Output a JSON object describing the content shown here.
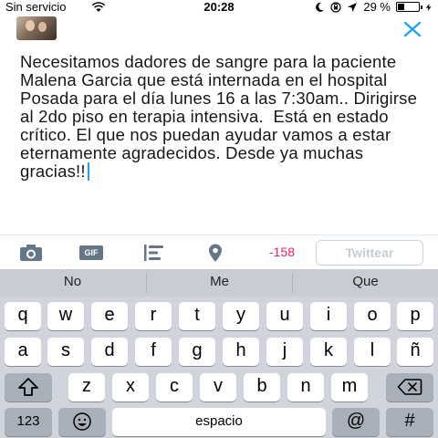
{
  "status_bar": {
    "carrier": "Sin servicio",
    "time": "20:28",
    "battery": "29 %",
    "battery_level": 0.29
  },
  "compose": {
    "tweet_text": "Necesitamos dadores de sangre para la paciente Malena Garcia que está internada en el hospital Posada para el día lunes 16 a las 7:30am.. Dirigirse al 2do piso en terapia intensiva.  Está en estado crítico. El que nos puedan ayudar vamos a estar eternamente agradecidos. Desde ya muchas gracias!!",
    "colors": {
      "accent": "#1da1f2",
      "counter": "#e0245e"
    }
  },
  "toolbar": {
    "gif_label": "GIF",
    "char_counter": "-158",
    "tweet_button": "Twittear"
  },
  "keyboard": {
    "predictions": [
      "No",
      "Me",
      "Que"
    ],
    "row1": [
      "q",
      "w",
      "e",
      "r",
      "t",
      "y",
      "u",
      "i",
      "o",
      "p"
    ],
    "row2": [
      "a",
      "s",
      "d",
      "f",
      "g",
      "h",
      "j",
      "k",
      "l",
      "ñ"
    ],
    "row3": [
      "z",
      "x",
      "c",
      "v",
      "b",
      "n",
      "m"
    ],
    "numbers_key": "123",
    "space_key": "espacio",
    "at_key": "@",
    "hash_key": "#"
  }
}
